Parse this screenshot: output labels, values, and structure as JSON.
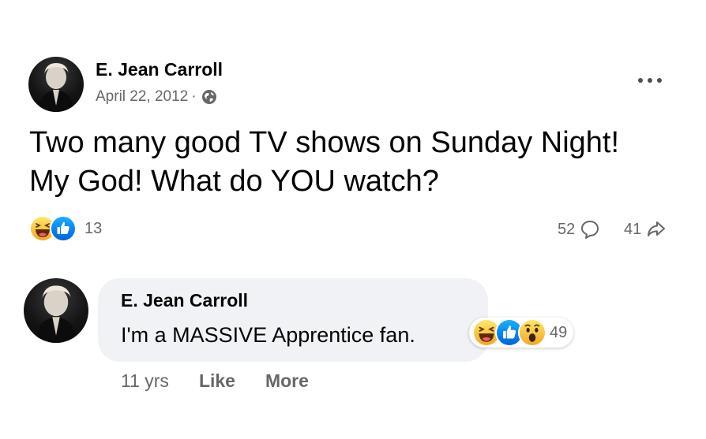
{
  "post": {
    "author": "E. Jean Carroll",
    "date": "April 22, 2012",
    "separator": "·",
    "privacy_icon": "globe-icon",
    "text": "Two many good TV shows on Sunday Night! My God! What do YOU watch?",
    "reactions": {
      "types": [
        "haha-icon",
        "like-icon"
      ],
      "count": "13"
    },
    "comments_count": "52",
    "shares_count": "41"
  },
  "comment": {
    "author": "E. Jean Carroll",
    "text": "I'm a MASSIVE Apprentice fan.",
    "reactions": {
      "types": [
        "haha-icon",
        "like-icon",
        "wow-icon"
      ],
      "count": "49"
    },
    "time": "11 yrs",
    "like_label": "Like",
    "more_label": "More"
  },
  "colors": {
    "like_blue": "#1877f2",
    "reaction_yellow": "#f7b125",
    "secondary_text": "#65676b",
    "bubble_bg": "#f0f2f5"
  }
}
